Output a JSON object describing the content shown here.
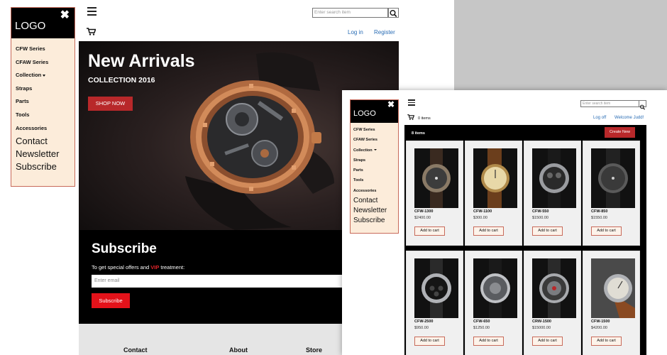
{
  "colors": {
    "accent": "#b8282a",
    "subscribe_red": "#e3121a",
    "link": "#2a6db5",
    "sidebar_bg": "#fcecda"
  },
  "sidebar": {
    "logo": "LOGO",
    "close": "✖",
    "small_items": [
      "CFW Series",
      "CFAW Series",
      "Collection",
      "Straps",
      "Parts",
      "Tools",
      "Accessories"
    ],
    "big_items": [
      "Contact",
      "Newsletter",
      "Subscribe"
    ]
  },
  "header": {
    "search_placeholder": "Enter search item",
    "login": "Log in",
    "register": "Register"
  },
  "hero": {
    "title": "New Arrivals",
    "subtitle": "COLLECTION 2016",
    "button": "SHOP NOW"
  },
  "subscribe": {
    "title": "Subscribe",
    "desc_before": "To get special offers and ",
    "desc_vip": "VIP",
    "desc_after": " treatment:",
    "email_placeholder": "Enter email",
    "button": "Subscribe"
  },
  "footer": {
    "cols": [
      "Contact",
      "About",
      "Store"
    ]
  },
  "window2": {
    "sidebar": {
      "logo": "LOGO",
      "close": "✖",
      "small_items": [
        "CFW Series",
        "CFAW Series",
        "Collection",
        "Straps",
        "Parts",
        "Tools",
        "Accessories"
      ],
      "big_items": [
        "Contact",
        "Newsletter",
        "Subscribe"
      ]
    },
    "search_placeholder": "Enter search item",
    "cart_count": "0 items",
    "logoff": "Log off",
    "welcome": "Welcome Judd!",
    "items_count": "8 items",
    "create_new": "Create New",
    "add_to_cart": "Add to cart",
    "products": [
      {
        "name": "CFW-1300",
        "price": "$2400.00"
      },
      {
        "name": "CFW-1100",
        "price": "$300.00"
      },
      {
        "name": "CFW-550",
        "price": "$1500.00"
      },
      {
        "name": "CFW-850",
        "price": "$1550.00"
      },
      {
        "name": "CFW-2500",
        "price": "$950.00"
      },
      {
        "name": "CFW-650",
        "price": "$1250.00"
      },
      {
        "name": "CRW-1500",
        "price": "$15000.00"
      },
      {
        "name": "CFW-1500",
        "price": "$4200.00"
      }
    ]
  }
}
